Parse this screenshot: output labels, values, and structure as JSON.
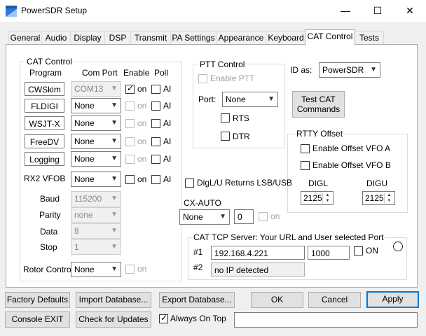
{
  "window": {
    "title": "PowerSDR Setup",
    "minimize": "—",
    "maximize": "☐",
    "close": "✕"
  },
  "tabs": [
    "General",
    "Audio",
    "Display",
    "DSP",
    "Transmit",
    "PA Settings",
    "Appearance",
    "Keyboard",
    "CAT Control",
    "Tests"
  ],
  "cat_control": {
    "legend": "CAT Control",
    "hdr_program": "Program",
    "hdr_comport": "Com Port",
    "hdr_enable": "Enable",
    "hdr_poll": "Poll",
    "rows": [
      {
        "program": "CWSkim",
        "port": "COM13",
        "enable_label": "on",
        "poll_label": "AI"
      },
      {
        "program": "FLDIGI",
        "port": "None",
        "enable_label": "on",
        "poll_label": "AI"
      },
      {
        "program": "WSJT-X",
        "port": "None",
        "enable_label": "on",
        "poll_label": "AI"
      },
      {
        "program": "FreeDV",
        "port": "None",
        "enable_label": "on",
        "poll_label": "AI"
      },
      {
        "program": "Logging",
        "port": "None",
        "enable_label": "on",
        "poll_label": "AI"
      }
    ],
    "rx2_label": "RX2 VFOB",
    "rx2_port": "None",
    "rx2_enable_label": "on",
    "rx2_poll_label": "AI",
    "baud_label": "Baud",
    "baud": "115200",
    "parity_label": "Parity",
    "parity": "none",
    "data_label": "Data",
    "data": "8",
    "stop_label": "Stop",
    "stop": "1",
    "rotor_label": "Rotor Control",
    "rotor_port": "None",
    "rotor_on": "on"
  },
  "ptt": {
    "legend": "PTT Control",
    "enable_ptt": "Enable PTT",
    "port_label": "Port:",
    "port": "None",
    "rts": "RTS",
    "dtr": "DTR"
  },
  "id_as": {
    "label": "ID as:",
    "value": "PowerSDR"
  },
  "test_cat": "Test CAT\nCommands",
  "rtty": {
    "legend": "RTTY Offset",
    "vfoa": "Enable Offset VFO A",
    "vfob": "Enable Offset VFO B",
    "digl_label": "DIGL",
    "digu_label": "DIGU",
    "digl": "2125",
    "digu": "2125"
  },
  "digl_returns": "DigL/U Returns LSB/USB",
  "cx_auto": {
    "label": "CX-AUTO",
    "combo": "None",
    "num": "0",
    "on": "on"
  },
  "tcp": {
    "legend": "CAT TCP Server:  Your URL and User selected Port",
    "n1": "#1",
    "n2": "#2",
    "url": "192.168.4.221",
    "port": "1000",
    "on": "ON",
    "status": "no IP detected"
  },
  "buttons": {
    "factory": "Factory Defaults",
    "import": "Import Database...",
    "export": "Export Database...",
    "ok": "OK",
    "cancel": "Cancel",
    "apply": "Apply",
    "console_exit": "Console EXIT",
    "check_updates": "Check for Updates",
    "always_on_top": "Always On Top"
  },
  "colors": {
    "accent": "#0078d7",
    "icon_blue": "#2b79d6"
  }
}
